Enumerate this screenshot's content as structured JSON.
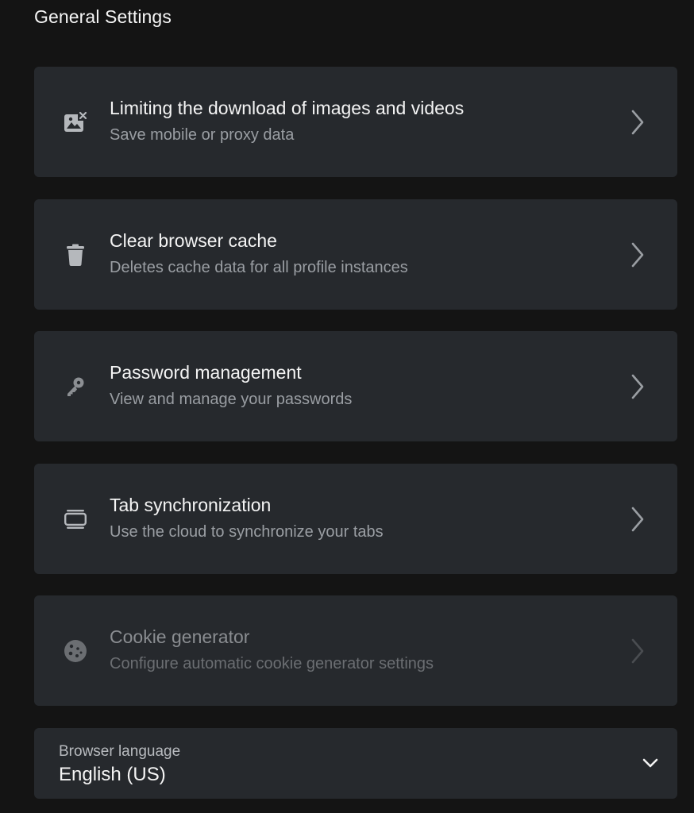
{
  "header": {
    "title": "General Settings"
  },
  "items": [
    {
      "id": "media-limit",
      "title": "Limiting the download of images and videos",
      "subtitle": "Save mobile or proxy data",
      "icon": "image-off-icon",
      "disabled": false
    },
    {
      "id": "clear-cache",
      "title": "Clear browser cache",
      "subtitle": "Deletes cache data for all profile instances",
      "icon": "trash-icon",
      "disabled": false
    },
    {
      "id": "passwords",
      "title": "Password management",
      "subtitle": "View and manage your passwords",
      "icon": "key-icon",
      "disabled": false
    },
    {
      "id": "tab-sync",
      "title": "Tab synchronization",
      "subtitle": "Use the cloud to synchronize your tabs",
      "icon": "tabs-stack-icon",
      "disabled": false
    },
    {
      "id": "cookie-generator",
      "title": "Cookie generator",
      "subtitle": "Configure automatic cookie generator settings",
      "icon": "cookie-icon",
      "disabled": true
    }
  ],
  "language": {
    "label": "Browser language",
    "value": "English (US)",
    "icon": "chevron-down-icon"
  },
  "colors": {
    "background": "#141414",
    "card": "#26292d",
    "text_primary": "#f4f4f4",
    "text_secondary": "#9a9ea3",
    "icon": "#b5b8bc",
    "icon_disabled": "#6b6e72"
  }
}
